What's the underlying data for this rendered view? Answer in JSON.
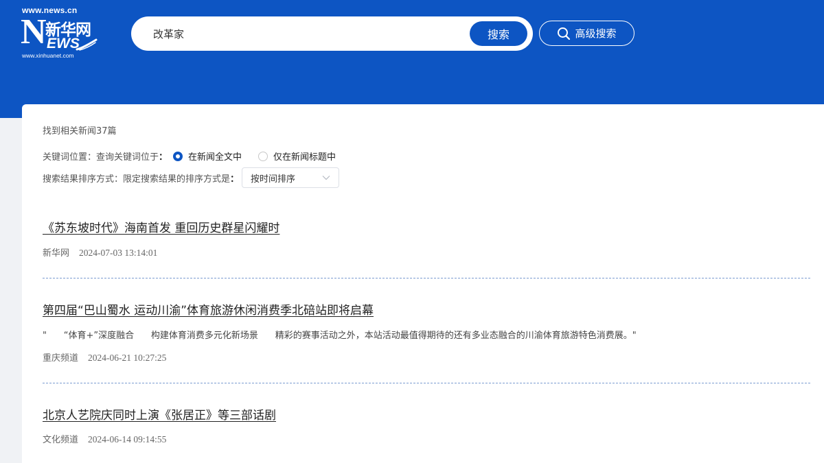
{
  "brand": {
    "logo_url_top": "www.news.cn",
    "logo_mark": "N",
    "logo_cn": "新华网",
    "logo_ews": "EWS",
    "logo_url_bottom": "www.xinhuanet.com",
    "primary_color": "#0d55c3"
  },
  "search": {
    "query": "改革家",
    "button_label": "搜索",
    "advanced_label": "高级搜索",
    "advanced_icon": "search-icon"
  },
  "results": {
    "count_text": "找到相关新闻37篇",
    "keyword_position": {
      "label": "关键词位置：查询关键词位于",
      "colon": "：",
      "options": [
        {
          "label": "在新闻全文中",
          "selected": true
        },
        {
          "label": "仅在新闻标题中",
          "selected": false
        }
      ]
    },
    "sort": {
      "label": "搜索结果排序方式：限定搜索结果的排序方式是",
      "colon": "：",
      "selected": "按时间排序"
    }
  },
  "articles": [
    {
      "title": "《苏东坡时代》海南首发 重回历史群星闪耀时",
      "snippet": "",
      "source": "新华网",
      "date": "2024-07-03 13:14:01"
    },
    {
      "title": "第四届“巴山蜀水 运动川渝”体育旅游休闲消费季北碚站即将启幕",
      "snippet": "\"      “体育+”深度融合      构建体育消费多元化新场景      精彩的赛事活动之外，本站活动最值得期待的还有多业态融合的川渝体育旅游特色消费展。\"",
      "source": "重庆频道",
      "date": "2024-06-21 10:27:25"
    },
    {
      "title": "北京人艺院庆同时上演《张居正》等三部话剧",
      "snippet": "",
      "source": "文化频道",
      "date": "2024-06-14 09:14:55"
    }
  ]
}
